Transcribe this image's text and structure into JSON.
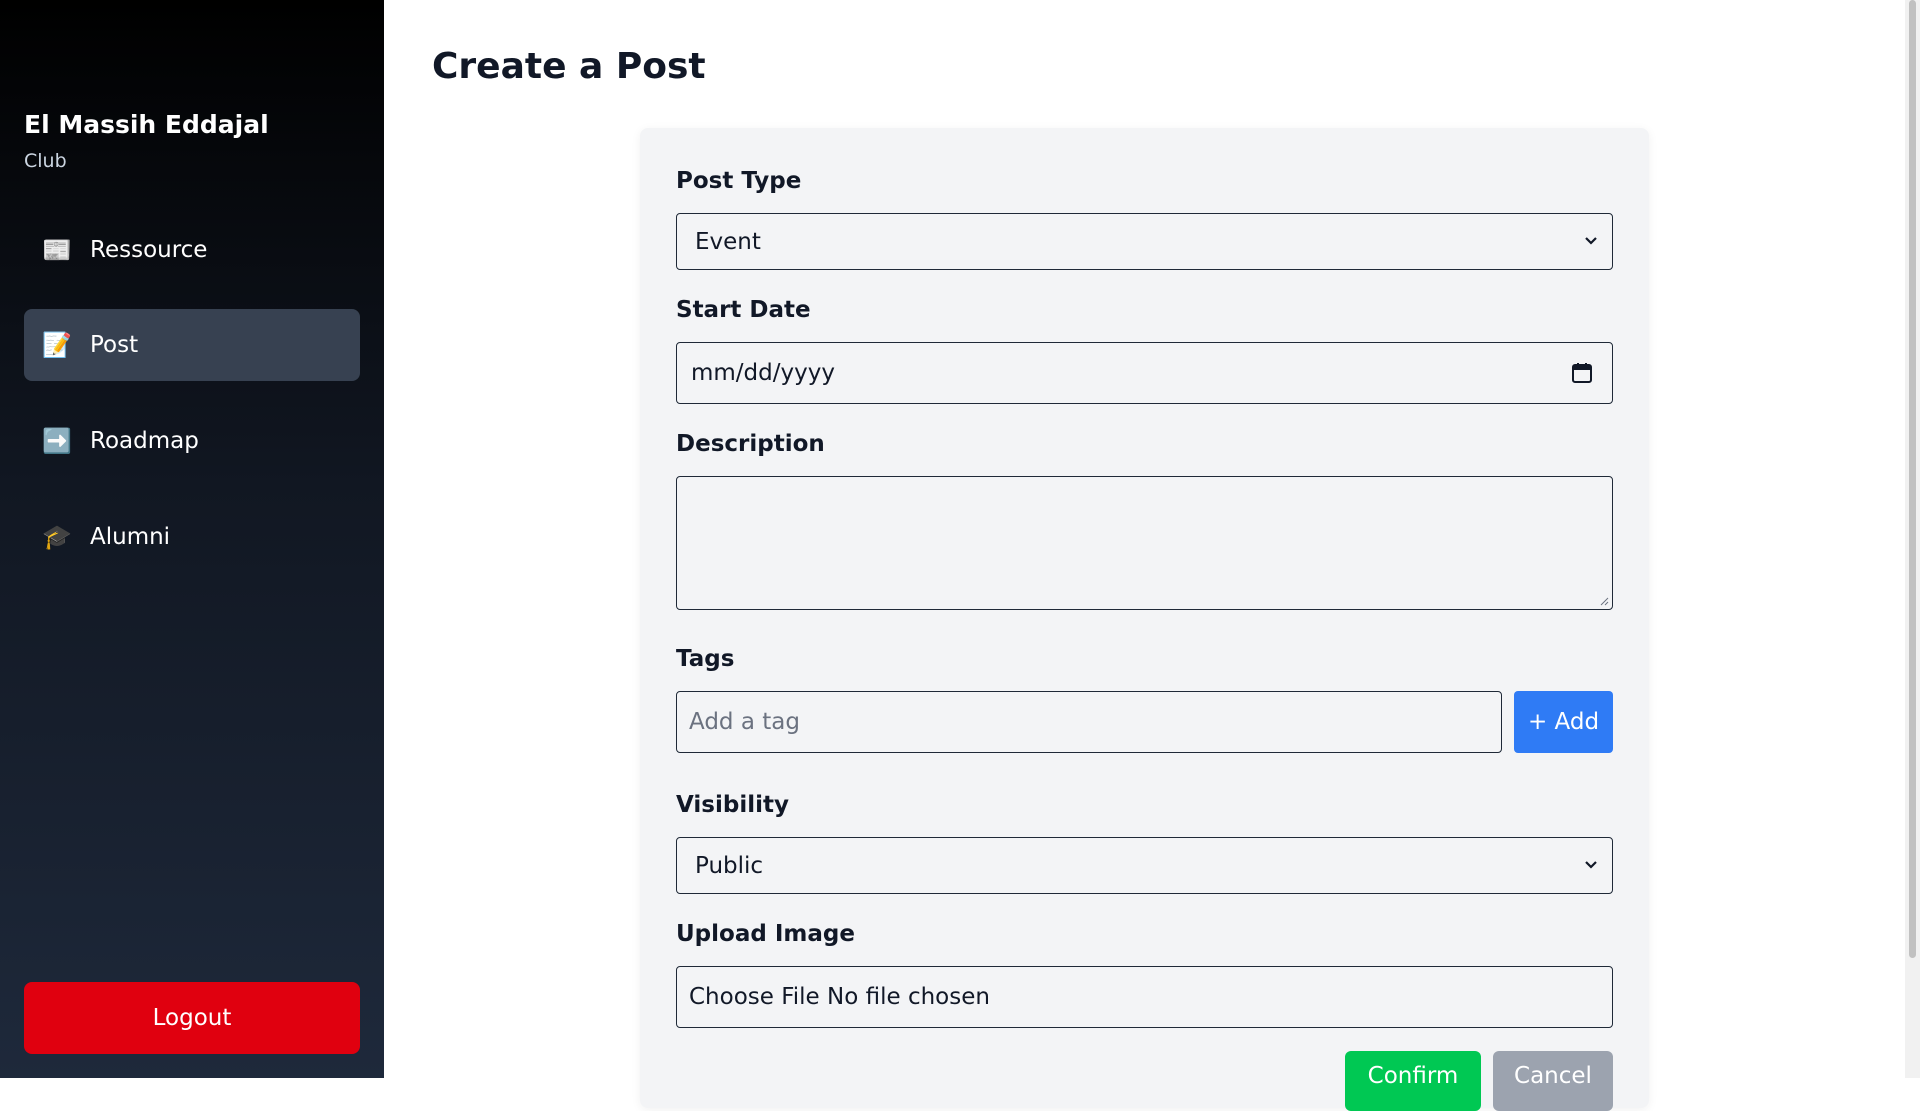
{
  "sidebar": {
    "brand_name": "El Massih Eddajal",
    "brand_sub": "Club",
    "items": [
      {
        "label": "Ressource",
        "icon": "newspaper-icon",
        "glyph": "📰",
        "active": false
      },
      {
        "label": "Post",
        "icon": "memo-icon",
        "glyph": "📝",
        "active": true
      },
      {
        "label": "Roadmap",
        "icon": "arrow-right-icon",
        "glyph": "➡️",
        "active": false
      },
      {
        "label": "Alumni",
        "icon": "graduation-cap-icon",
        "glyph": "🎓",
        "active": false
      }
    ],
    "logout_label": "Logout"
  },
  "main": {
    "title": "Create a Post",
    "form": {
      "post_type": {
        "label": "Post Type",
        "value": "Event"
      },
      "start_date": {
        "label": "Start Date",
        "placeholder": "mm/dd/yyyy"
      },
      "description": {
        "label": "Description",
        "value": ""
      },
      "tags": {
        "label": "Tags",
        "placeholder": "Add a tag",
        "add_label": "+ Add"
      },
      "visibility": {
        "label": "Visibility",
        "value": "Public"
      },
      "upload": {
        "label": "Upload Image",
        "button_text": "Choose File",
        "status": "No file chosen"
      },
      "confirm_label": "Confirm",
      "cancel_label": "Cancel"
    }
  },
  "colors": {
    "sidebar_top": "#000000",
    "sidebar_bottom": "#1e293b",
    "active_item": "#374151",
    "logout": "#e0000f",
    "add_button": "#2f7bf5",
    "confirm_button": "#00c853",
    "cancel_button": "#9ca3af",
    "card_bg": "#f3f4f6"
  }
}
